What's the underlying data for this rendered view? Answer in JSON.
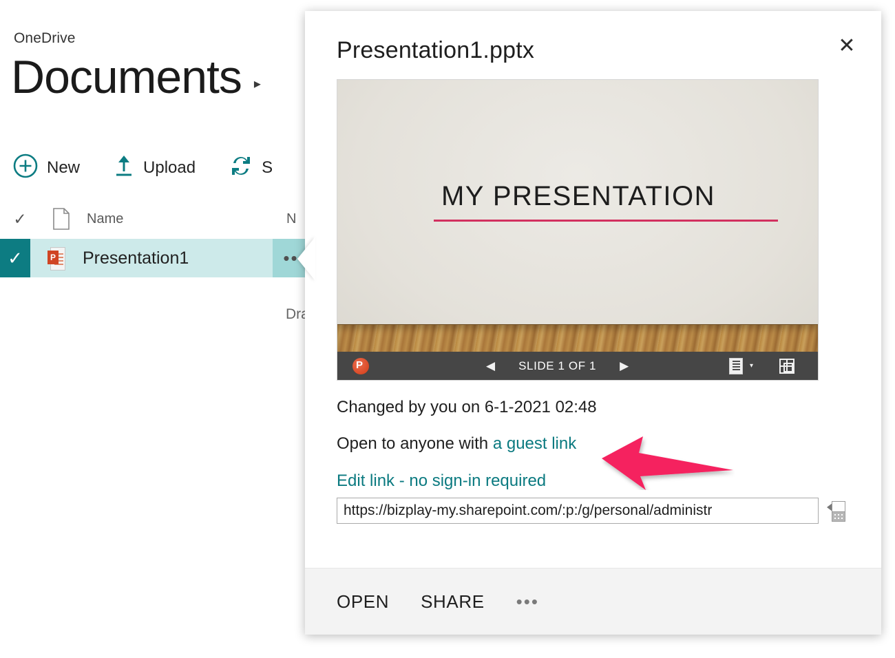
{
  "background": {
    "service_name": "OneDrive",
    "page_title": "Documents",
    "title_chevron": "▸",
    "commands": [
      {
        "label": "New",
        "icon": "plus-circle-icon"
      },
      {
        "label": "Upload",
        "icon": "upload-arrow-icon"
      },
      {
        "label": "S",
        "icon": "sync-icon"
      }
    ],
    "list_header": {
      "check": "✓",
      "file_icon": "blank-document-icon",
      "name": "Name",
      "modified": "N"
    },
    "row": {
      "checked": "✓",
      "file_icon_badge": "P",
      "name": "Presentation1",
      "ellipsis": "•••"
    },
    "drag_hint": "Dra"
  },
  "dialog": {
    "title": "Presentation1.pptx",
    "close": "✕",
    "preview": {
      "slide_title": "MY PRESENTATION",
      "toolbar": {
        "logo": "powerpoint-logo-icon",
        "prev": "◀",
        "slide_count": "SLIDE 1 OF 1",
        "next": "▶",
        "notes_icon": "notes-icon",
        "notes_caret": "▾",
        "fullscreen_icon": "fullscreen-icon"
      }
    },
    "changed_by": "Changed by you on 6-1-2021 02:48",
    "sharing_prefix": "Open to anyone with ",
    "sharing_link": "a guest link",
    "edit_link_label": "Edit link - no sign-in required",
    "url_value": "https://bizplay-my.sharepoint.com/:p:/g/personal/administr",
    "copy_icon": "copy-to-clipboard-icon",
    "footer": {
      "open": "OPEN",
      "share": "SHARE",
      "more": "•••"
    }
  },
  "annotation": {
    "arrow_color": "#F5225F",
    "direction": "left"
  },
  "colors": {
    "accent_teal": "#0b7a80",
    "row_selected": "#cdeaea",
    "check_cell": "#0d7c82",
    "hover_cell": "#9fd7d7",
    "slide_rule": "#d2305f",
    "toolbar_bg": "#464646",
    "footer_bg": "#f3f3f3"
  }
}
